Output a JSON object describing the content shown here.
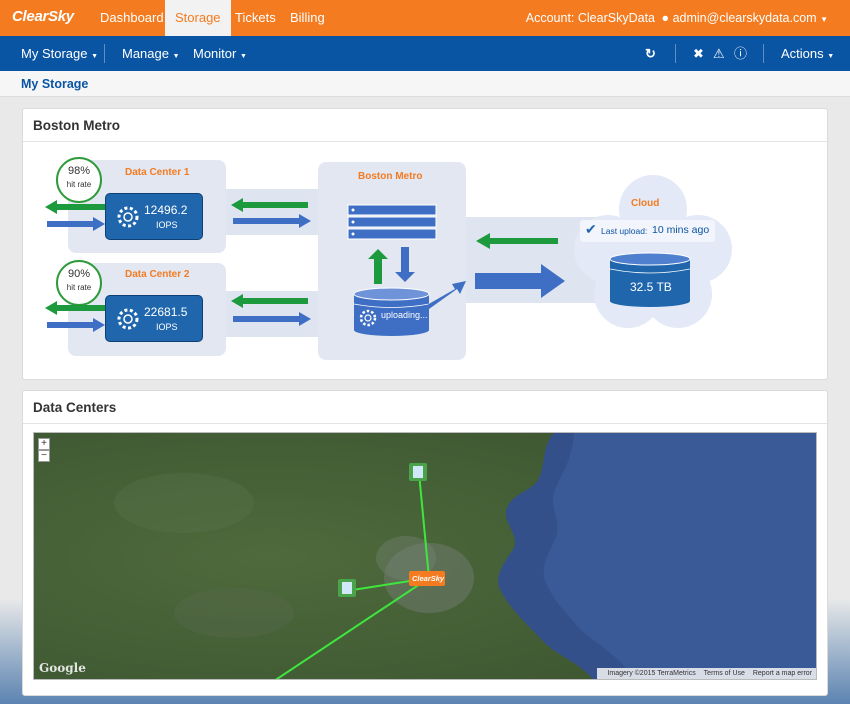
{
  "brand": "ClearSky",
  "topnav": [
    "Dashboard",
    "Storage",
    "Tickets",
    "Billing"
  ],
  "account": "Account: ClearSkyData",
  "user": "admin@clearskydata.com",
  "subnav": {
    "my_storage": "My Storage",
    "manage": "Manage",
    "monitor": "Monitor",
    "actions": "Actions"
  },
  "breadcrumb": "My Storage",
  "metro_panel": {
    "title": "Boston Metro",
    "dc1": {
      "name": "Data Center 1",
      "iops": "12496.2",
      "unit": "IOPS",
      "hit_pct": "98%",
      "hit_label": "hit rate"
    },
    "dc2": {
      "name": "Data Center 2",
      "iops": "22681.5",
      "unit": "IOPS",
      "hit_pct": "90%",
      "hit_label": "hit rate"
    },
    "metro": {
      "name": "Boston Metro",
      "status": "uploading..."
    },
    "cloud": {
      "name": "Cloud",
      "last_upload_label": "Last upload:",
      "last_upload_value": "10 mins ago",
      "capacity": "32.5 TB"
    }
  },
  "dc_panel": {
    "title": "Data Centers",
    "map_logo": "Google",
    "map_badge": "ClearSky",
    "zoom_in": "+",
    "zoom_out": "−",
    "footer": [
      "Imagery ©2015 TerraMetrics",
      "Terms of Use",
      "Report a map error"
    ]
  },
  "colors": {
    "orange": "#f47b20",
    "blue": "#0a54a4",
    "green": "#1e9a3e",
    "arrow_blue": "#3f6fc4"
  }
}
